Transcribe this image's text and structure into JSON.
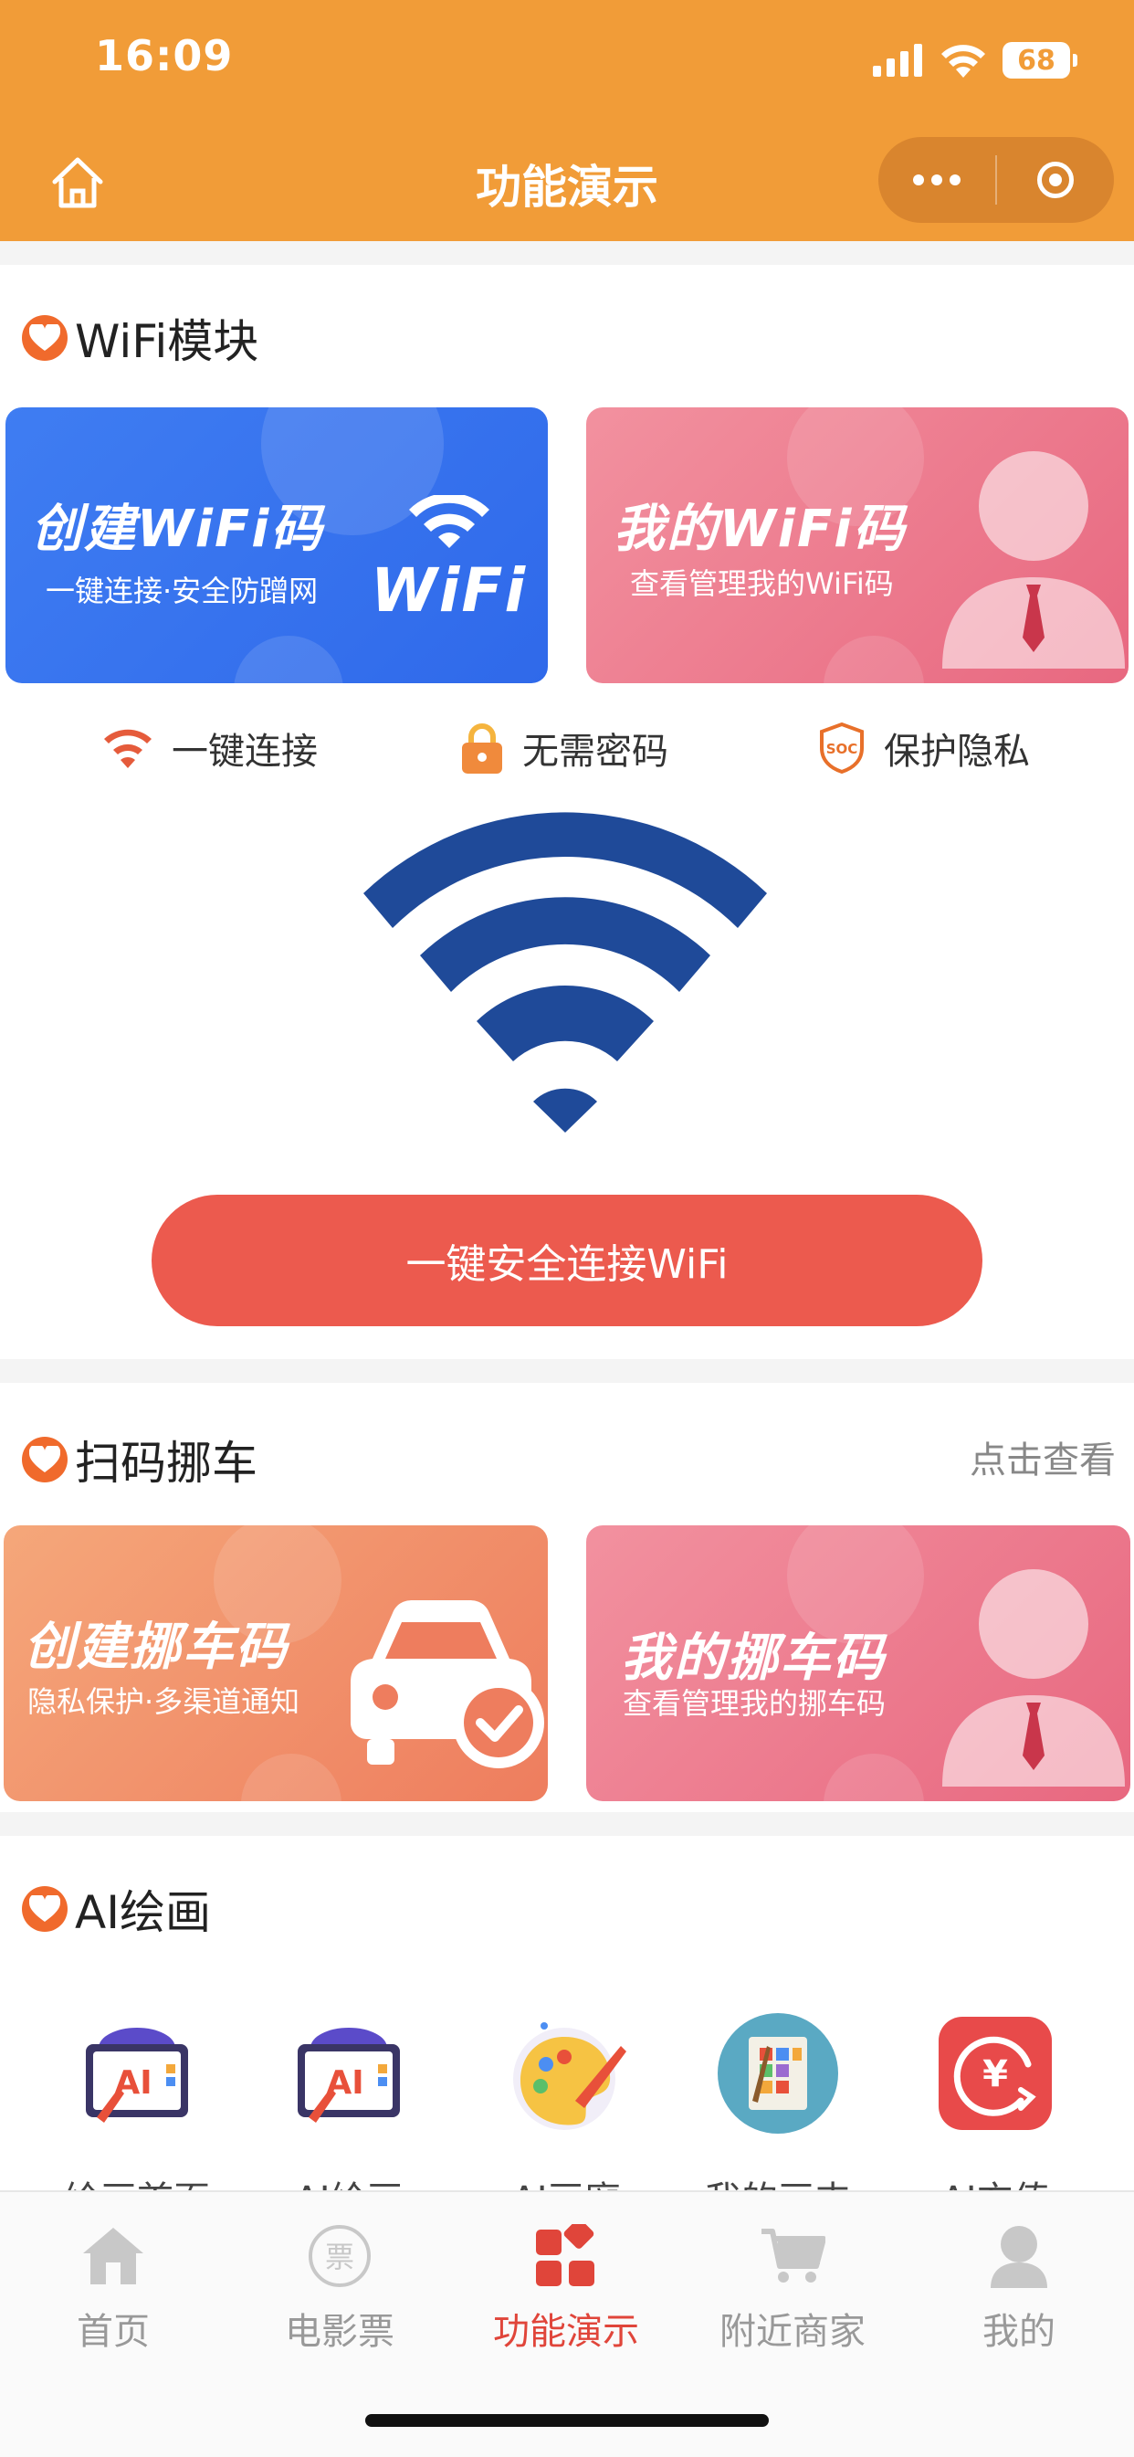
{
  "status_bar": {
    "time": "16:09",
    "battery": "68"
  },
  "nav": {
    "title": "功能演示"
  },
  "wifi_section": {
    "title": "WiFi模块",
    "card_create": {
      "title": "创建WiFi码",
      "subtitle": "一键连接·安全防蹭网",
      "logo_text": "WiFi"
    },
    "card_mine": {
      "title": "我的WiFi码",
      "subtitle": "查看管理我的WiFi码"
    },
    "features": [
      {
        "icon": "wifi-icon",
        "label": "一键连接"
      },
      {
        "icon": "lock-icon",
        "label": "无需密码"
      },
      {
        "icon": "soc-shield-icon",
        "label": "保护隐私"
      }
    ],
    "connect_button": "一键安全连接WiFi"
  },
  "move_car_section": {
    "title": "扫码挪车",
    "more": "点击查看",
    "card_create": {
      "title": "创建挪车码",
      "subtitle": "隐私保护·多渠道通知"
    },
    "card_mine": {
      "title": "我的挪车码",
      "subtitle": "查看管理我的挪车码"
    }
  },
  "ai_section": {
    "title": "AI绘画",
    "items": [
      {
        "icon": "ai-painting-board-icon",
        "label": "绘画首页"
      },
      {
        "icon": "ai-painting-board-icon",
        "label": "AI绘画"
      },
      {
        "icon": "palette-icon",
        "label": "AI画廊"
      },
      {
        "icon": "gallery-icon",
        "label": "我的画夹"
      },
      {
        "icon": "recharge-icon",
        "label": "AI充值"
      }
    ]
  },
  "tabbar": [
    {
      "icon": "home-icon",
      "label": "首页",
      "active": false
    },
    {
      "icon": "ticket-icon",
      "label": "电影票",
      "active": false
    },
    {
      "icon": "grid-icon",
      "label": "功能演示",
      "active": true
    },
    {
      "icon": "cart-icon",
      "label": "附近商家",
      "active": false
    },
    {
      "icon": "user-icon",
      "label": "我的",
      "active": false
    }
  ],
  "colors": {
    "primary": "#F19C38",
    "accent_red": "#EC5A4E",
    "wifi_blue": "#1F4A99",
    "active_tab": "#E0453A"
  }
}
